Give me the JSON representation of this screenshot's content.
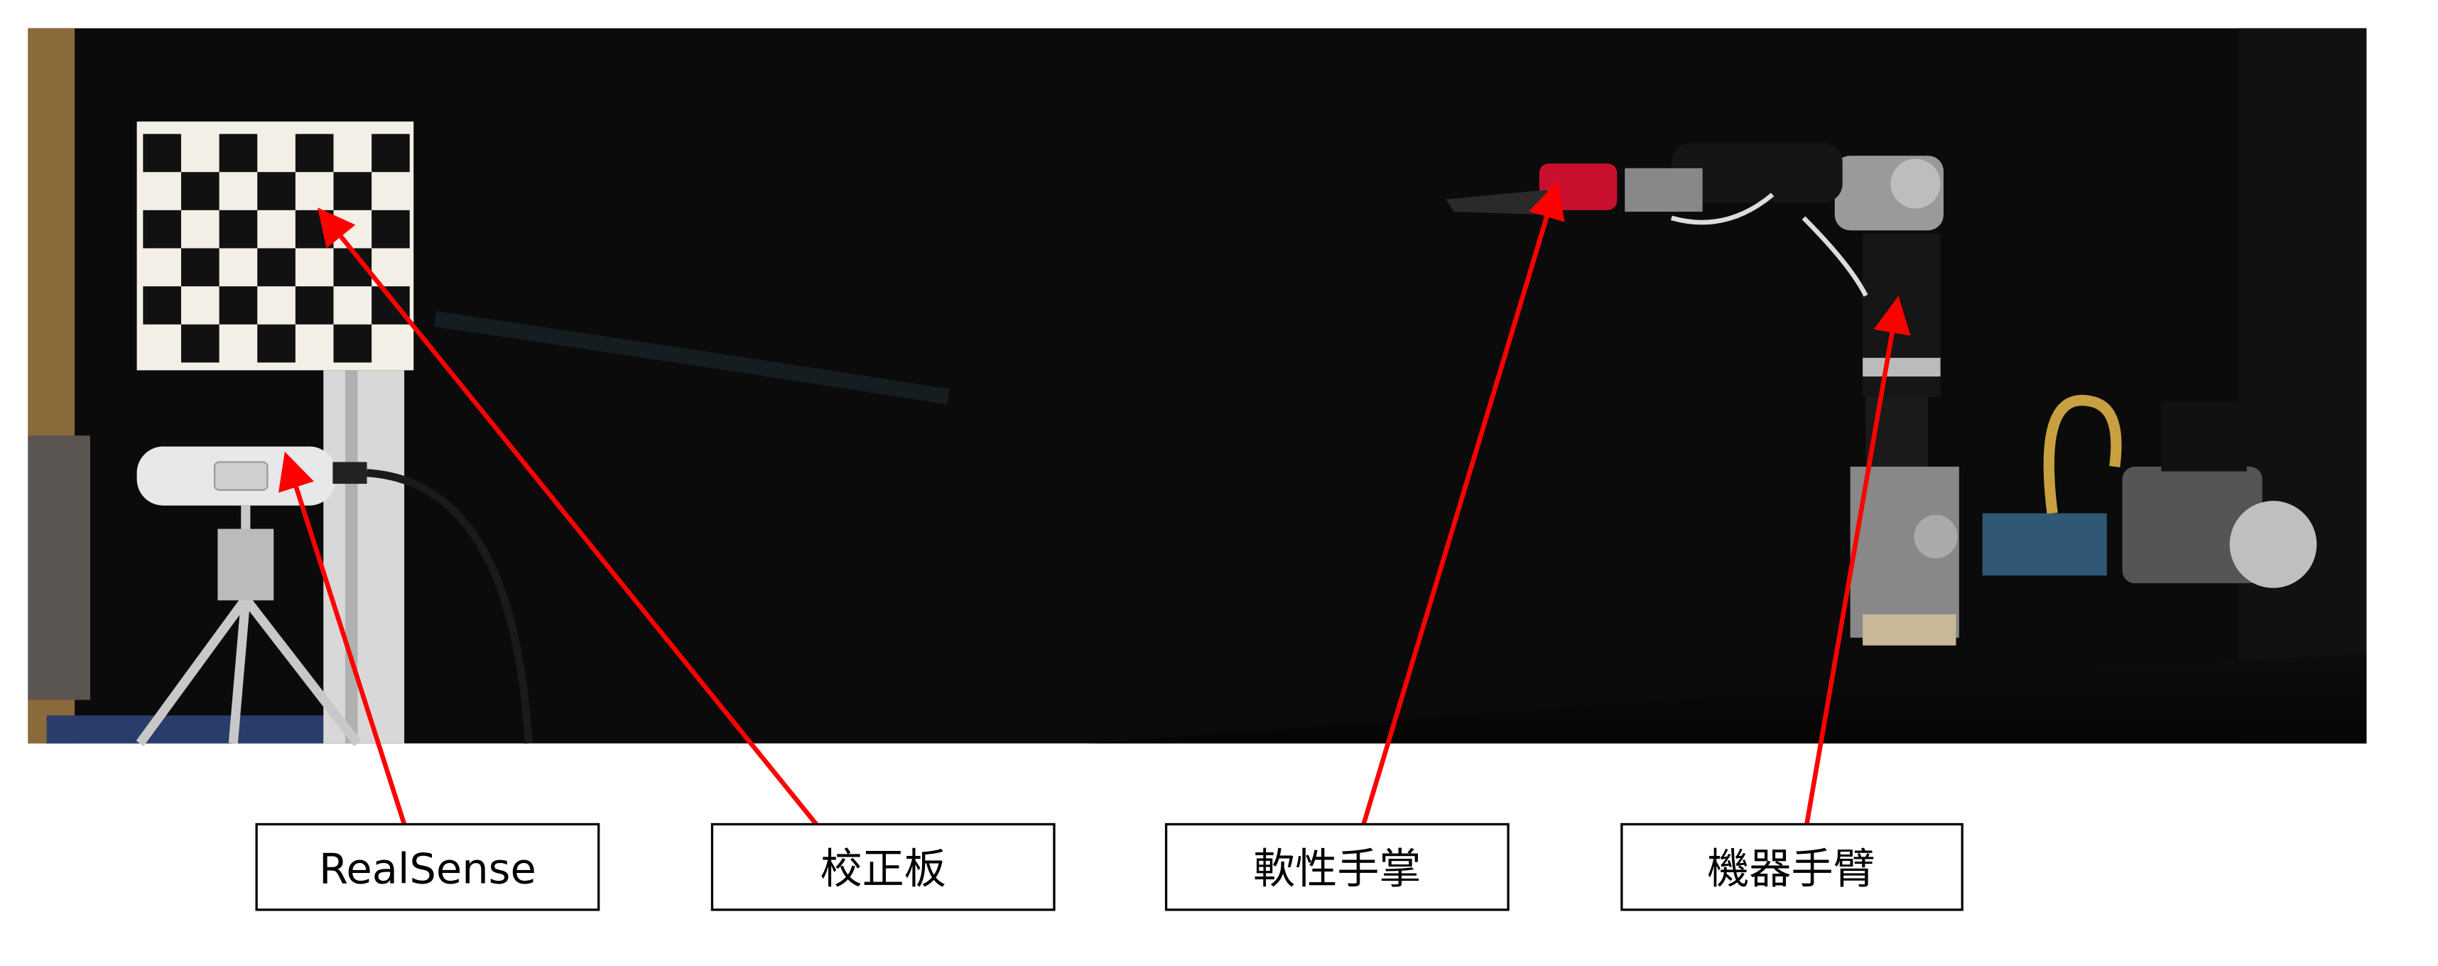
{
  "labels": {
    "realsense": "RealSense",
    "calibration_board": "校正板",
    "soft_palm": "軟性手掌",
    "robot_arm": "機器手臂"
  },
  "colors": {
    "arrow": "#ff0000",
    "backdrop": "#0b0b0c",
    "label_border": "#000000"
  }
}
